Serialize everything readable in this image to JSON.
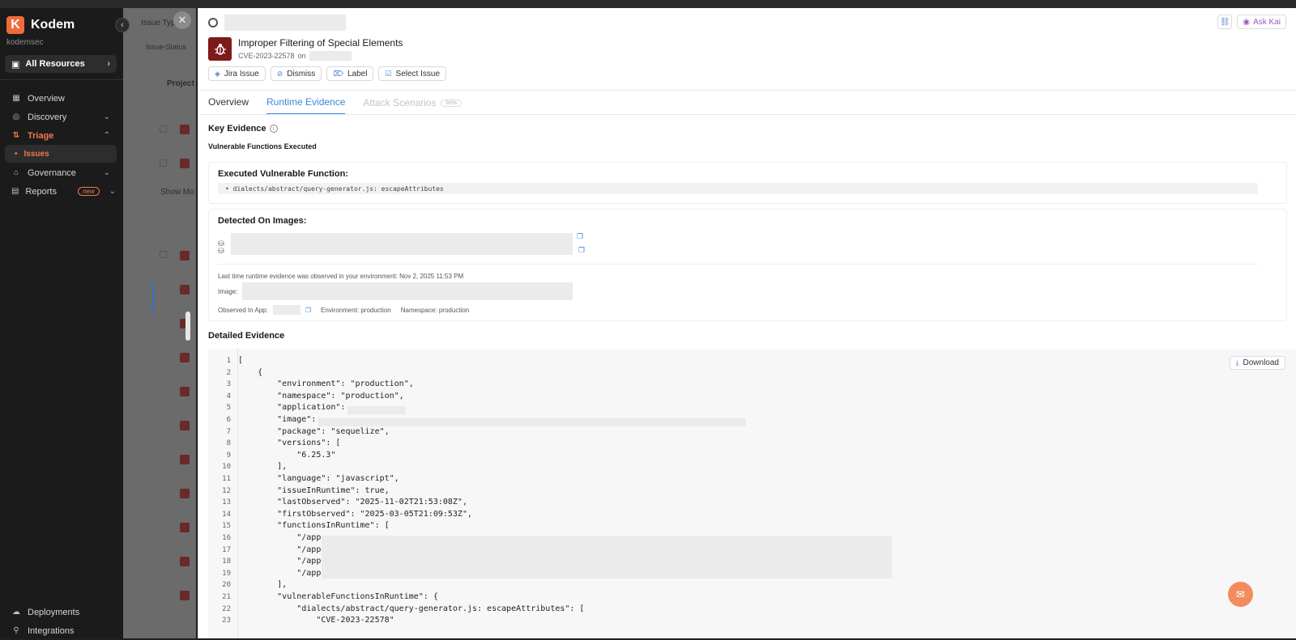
{
  "app": {
    "name": "Kodem",
    "org": "kodemsec",
    "logo_letter": "K"
  },
  "sidebar": {
    "all_resources": "All Resources",
    "items": [
      {
        "label": "Overview",
        "icon": "grid-icon"
      },
      {
        "label": "Discovery",
        "icon": "compass-icon"
      },
      {
        "label": "Triage",
        "icon": "sort-icon"
      },
      {
        "label": "Governance",
        "icon": "bank-icon"
      },
      {
        "label": "Reports",
        "icon": "report-icon",
        "badge": "new"
      }
    ],
    "sub_item": "Issues",
    "bottom": [
      {
        "label": "Deployments"
      },
      {
        "label": "Integrations"
      }
    ]
  },
  "background": {
    "filter_label": "Issue Type",
    "filter_chip": "Issue-Status",
    "column": "Project",
    "show_more": "Show Mo"
  },
  "panel": {
    "ask_kai": "Ask Kai",
    "issue_title": "Improper Filtering of Special Elements",
    "cve": "CVE-2023-22578",
    "on": "on",
    "actions": [
      "Jira Issue",
      "Dismiss",
      "Label",
      "Select Issue"
    ],
    "tabs": [
      "Overview",
      "Runtime Evidence",
      "Attack Scenarios"
    ],
    "tab_beta": "beta",
    "key_evidence": "Key Evidence",
    "vulnerable_functions": "Vulnerable Functions Executed",
    "executed_title": "Executed Vulnerable Function:",
    "executed_function": "• dialects/abstract/query-generator.js: escapeAttributes",
    "detected_title": "Detected On Images:",
    "last_observed": "Last time runtime evidence was observed in your environment: Nov 2, 2025 11:53 PM",
    "image_label": "Image:",
    "observed_in_app": "Observed In App:",
    "environment": "Environment: production",
    "namespace": "Namespace: production",
    "detailed_evidence": "Detailed Evidence",
    "download": "Download"
  },
  "code_lines": [
    "[",
    "    {",
    "        \"environment\": \"production\",",
    "        \"namespace\": \"production\",",
    "        \"application\": ",
    "        \"image\": ",
    "        \"package\": \"sequelize\",",
    "        \"versions\": [",
    "            \"6.25.3\"",
    "        ],",
    "        \"language\": \"javascript\",",
    "        \"issueInRuntime\": true,",
    "        \"lastObserved\": \"2025-11-02T21:53:08Z\",",
    "        \"firstObserved\": \"2025-03-05T21:09:53Z\",",
    "        \"functionsInRuntime\": [",
    "            \"/app.",
    "            \"/app.",
    "            \"/app.",
    "            \"/app.",
    "        ],",
    "        \"vulnerableFunctionsInRuntime\": {",
    "            \"dialects/abstract/query-generator.js: escapeAttributes\": [",
    "                \"CVE-2023-22578\""
  ],
  "line_numbers": [
    "1",
    "2",
    "3",
    "4",
    "5",
    "6",
    "7",
    "8",
    "9",
    "10",
    "11",
    "12",
    "13",
    "14",
    "15",
    "16",
    "17",
    "18",
    "19",
    "20",
    "21",
    "22",
    "23"
  ],
  "colors": {
    "accent": "#f07a4a",
    "link": "#3b86d8",
    "bug": "#7d1a1a"
  }
}
